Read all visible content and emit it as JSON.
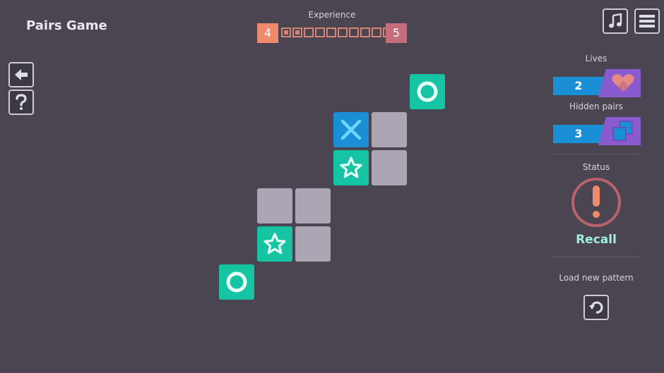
{
  "header": {
    "title": "Pairs Game",
    "experience_label": "Experience",
    "current_level": "4",
    "next_level": "5",
    "xp_segments_total": 10,
    "xp_segments_filled": 2
  },
  "toolbar": {
    "music_icon": "music-note-icon",
    "menu_icon": "hamburger-menu-icon",
    "back_icon": "arrow-left-icon",
    "help_icon": "question-mark-icon"
  },
  "sidebar": {
    "lives_label": "Lives",
    "lives_value": "2",
    "hidden_pairs_label": "Hidden pairs",
    "hidden_pairs_value": "3",
    "status_label": "Status",
    "status_value": "Recall",
    "load_label": "Load new pattern"
  },
  "board": {
    "tiles": [
      {
        "row": 0,
        "col": 5,
        "state": "revealed",
        "symbol": "circle"
      },
      {
        "row": 1,
        "col": 3,
        "state": "revealed",
        "symbol": "cross"
      },
      {
        "row": 1,
        "col": 4,
        "state": "hidden"
      },
      {
        "row": 2,
        "col": 3,
        "state": "revealed",
        "symbol": "star"
      },
      {
        "row": 2,
        "col": 4,
        "state": "hidden"
      },
      {
        "row": 3,
        "col": 1,
        "state": "hidden"
      },
      {
        "row": 3,
        "col": 2,
        "state": "hidden"
      },
      {
        "row": 4,
        "col": 1,
        "state": "revealed",
        "symbol": "star"
      },
      {
        "row": 4,
        "col": 2,
        "state": "hidden"
      },
      {
        "row": 5,
        "col": 0,
        "state": "revealed",
        "symbol": "circle"
      }
    ]
  },
  "colors": {
    "background": "#4a4551",
    "teal_tile": "#14c4a2",
    "blue_tile": "#1a8fd6",
    "hidden_tile": "#aca5b3",
    "status_ring": "#b5636c",
    "status_exclaim": "#f08a6d",
    "counter_purple": "#8a5bcf"
  }
}
